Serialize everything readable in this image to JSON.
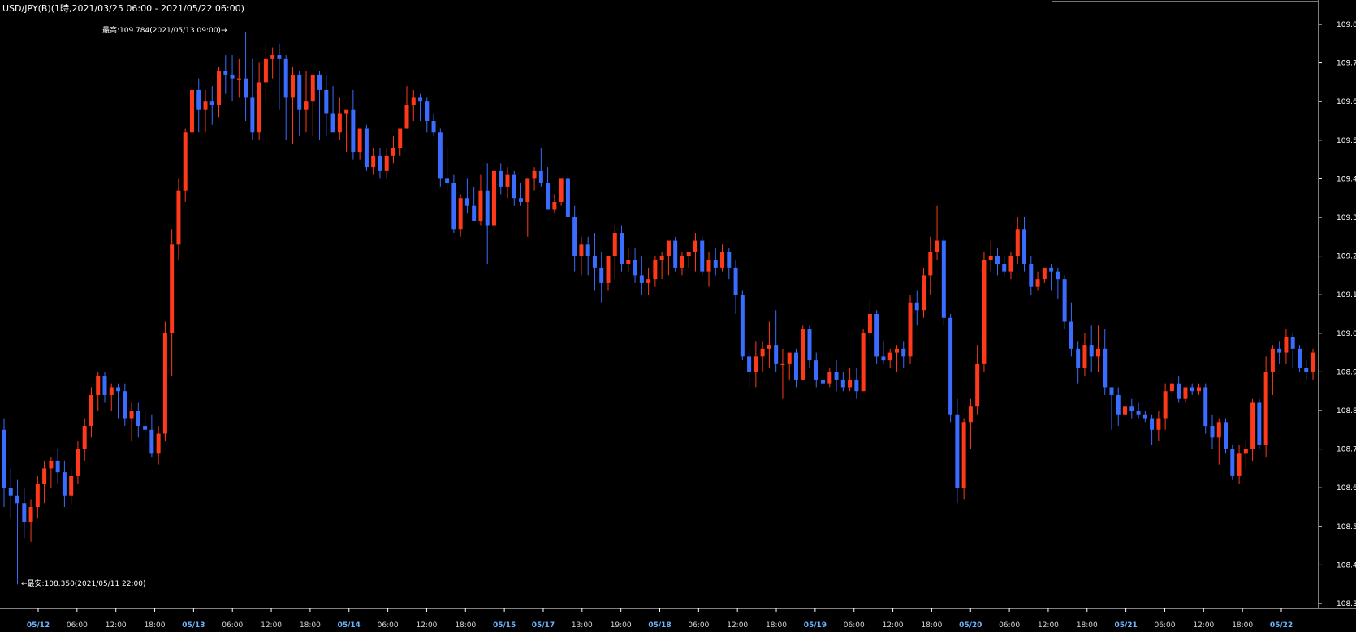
{
  "chart_data": {
    "type": "candlestick",
    "title": "USD/JPY(B)(1時,2021/03/25 06:00 - 2021/05/22 06:00)",
    "annotations": {
      "high": "最高:109.784(2021/05/13 09:00)→",
      "low": "←最安:108.350(2021/05/11 22:00)"
    },
    "ylim": [
      108.27,
      109.86
    ],
    "y_ticks": [
      "109.8",
      "109.7",
      "109.6",
      "109.5",
      "109.4",
      "109.3",
      "109.2",
      "109.1",
      "109.0",
      "108.9",
      "108.8",
      "108.7",
      "108.6",
      "108.5",
      "108.4",
      "108.3"
    ],
    "x_ticks": [
      {
        "label": "05/12",
        "date": true
      },
      {
        "label": "06:00",
        "date": false
      },
      {
        "label": "12:00",
        "date": false
      },
      {
        "label": "18:00",
        "date": false
      },
      {
        "label": "05/13",
        "date": true
      },
      {
        "label": "06:00",
        "date": false
      },
      {
        "label": "12:00",
        "date": false
      },
      {
        "label": "18:00",
        "date": false
      },
      {
        "label": "05/14",
        "date": true
      },
      {
        "label": "06:00",
        "date": false
      },
      {
        "label": "12:00",
        "date": false
      },
      {
        "label": "18:00",
        "date": false
      },
      {
        "label": "05/15",
        "date": true
      },
      {
        "label": "05/17",
        "date": true
      },
      {
        "label": "13:00",
        "date": false
      },
      {
        "label": "19:00",
        "date": false
      },
      {
        "label": "05/18",
        "date": true
      },
      {
        "label": "06:00",
        "date": false
      },
      {
        "label": "12:00",
        "date": false
      },
      {
        "label": "18:00",
        "date": false
      },
      {
        "label": "05/19",
        "date": true
      },
      {
        "label": "06:00",
        "date": false
      },
      {
        "label": "12:00",
        "date": false
      },
      {
        "label": "18:00",
        "date": false
      },
      {
        "label": "05/20",
        "date": true
      },
      {
        "label": "06:00",
        "date": false
      },
      {
        "label": "12:00",
        "date": false
      },
      {
        "label": "18:00",
        "date": false
      },
      {
        "label": "05/21",
        "date": true
      },
      {
        "label": "06:00",
        "date": false
      },
      {
        "label": "12:00",
        "date": false
      },
      {
        "label": "18:00",
        "date": false
      },
      {
        "label": "05/22",
        "date": true
      }
    ],
    "colors": {
      "up": "#ff3a1a",
      "down": "#3a6cff",
      "background": "#000000",
      "axis": "#ffffff",
      "text": "#ffffff",
      "date_label": "#6fb4ff"
    },
    "candles": [
      [
        108.75,
        108.78,
        108.55,
        108.6
      ],
      [
        108.6,
        108.65,
        108.52,
        108.58
      ],
      [
        108.58,
        108.62,
        108.35,
        108.56
      ],
      [
        108.56,
        108.6,
        108.47,
        108.51
      ],
      [
        108.51,
        108.57,
        108.46,
        108.55
      ],
      [
        108.55,
        108.63,
        108.52,
        108.61
      ],
      [
        108.61,
        108.67,
        108.56,
        108.65
      ],
      [
        108.65,
        108.68,
        108.6,
        108.67
      ],
      [
        108.67,
        108.7,
        108.61,
        108.64
      ],
      [
        108.64,
        108.67,
        108.55,
        108.58
      ],
      [
        108.58,
        108.65,
        108.56,
        108.63
      ],
      [
        108.63,
        108.72,
        108.61,
        108.7
      ],
      [
        108.7,
        108.78,
        108.67,
        108.76
      ],
      [
        108.76,
        108.86,
        108.73,
        108.84
      ],
      [
        108.84,
        108.9,
        108.8,
        108.89
      ],
      [
        108.89,
        108.9,
        108.82,
        108.84
      ],
      [
        108.84,
        108.87,
        108.8,
        108.86
      ],
      [
        108.86,
        108.87,
        108.78,
        108.85
      ],
      [
        108.85,
        108.87,
        108.76,
        108.78
      ],
      [
        108.78,
        108.82,
        108.72,
        108.8
      ],
      [
        108.8,
        108.82,
        108.73,
        108.76
      ],
      [
        108.76,
        108.8,
        108.71,
        108.75
      ],
      [
        108.75,
        108.79,
        108.68,
        108.69
      ],
      [
        108.69,
        108.76,
        108.66,
        108.74
      ],
      [
        108.74,
        109.03,
        108.72,
        109.0
      ],
      [
        109.0,
        109.27,
        108.89,
        109.23
      ],
      [
        109.23,
        109.4,
        109.19,
        109.37
      ],
      [
        109.37,
        109.53,
        109.34,
        109.52
      ],
      [
        109.52,
        109.65,
        109.49,
        109.63
      ],
      [
        109.63,
        109.66,
        109.52,
        109.58
      ],
      [
        109.58,
        109.63,
        109.52,
        109.6
      ],
      [
        109.6,
        109.64,
        109.54,
        109.59
      ],
      [
        109.59,
        109.69,
        109.56,
        109.68
      ],
      [
        109.68,
        109.72,
        109.62,
        109.67
      ],
      [
        109.67,
        109.72,
        109.6,
        109.66
      ],
      [
        109.66,
        109.71,
        109.61,
        109.66
      ],
      [
        109.66,
        109.78,
        109.55,
        109.61
      ],
      [
        109.61,
        109.71,
        109.5,
        109.52
      ],
      [
        109.52,
        109.7,
        109.5,
        109.65
      ],
      [
        109.65,
        109.75,
        109.6,
        109.71
      ],
      [
        109.71,
        109.74,
        109.66,
        109.72
      ],
      [
        109.72,
        109.75,
        109.58,
        109.71
      ],
      [
        109.71,
        109.72,
        109.5,
        109.61
      ],
      [
        109.61,
        109.69,
        109.49,
        109.67
      ],
      [
        109.67,
        109.68,
        109.51,
        109.58
      ],
      [
        109.58,
        109.68,
        109.52,
        109.6
      ],
      [
        109.6,
        109.66,
        109.51,
        109.67
      ],
      [
        109.67,
        109.68,
        109.5,
        109.63
      ],
      [
        109.63,
        109.67,
        109.51,
        109.57
      ],
      [
        109.57,
        109.64,
        109.54,
        109.52
      ],
      [
        109.52,
        109.61,
        109.5,
        109.57
      ],
      [
        109.57,
        109.58,
        109.47,
        109.58
      ],
      [
        109.58,
        109.63,
        109.45,
        109.47
      ],
      [
        109.47,
        109.52,
        109.45,
        109.53
      ],
      [
        109.53,
        109.54,
        109.42,
        109.43
      ],
      [
        109.43,
        109.48,
        109.41,
        109.46
      ],
      [
        109.46,
        109.48,
        109.4,
        109.42
      ],
      [
        109.42,
        109.48,
        109.4,
        109.46
      ],
      [
        109.46,
        109.51,
        109.44,
        109.48
      ],
      [
        109.48,
        109.53,
        109.46,
        109.53
      ],
      [
        109.53,
        109.64,
        109.53,
        109.59
      ],
      [
        109.59,
        109.63,
        109.55,
        109.61
      ],
      [
        109.61,
        109.62,
        109.55,
        109.6
      ],
      [
        109.6,
        109.61,
        109.52,
        109.55
      ],
      [
        109.55,
        109.57,
        109.51,
        109.52
      ],
      [
        109.52,
        109.53,
        109.38,
        109.4
      ],
      [
        109.4,
        109.48,
        109.37,
        109.39
      ],
      [
        109.39,
        109.41,
        109.26,
        109.27
      ],
      [
        109.27,
        109.36,
        109.25,
        109.35
      ],
      [
        109.35,
        109.4,
        109.31,
        109.33
      ],
      [
        109.33,
        109.38,
        109.29,
        109.29
      ],
      [
        109.29,
        109.41,
        109.28,
        109.37
      ],
      [
        109.37,
        109.44,
        109.18,
        109.28
      ],
      [
        109.28,
        109.45,
        109.26,
        109.42
      ],
      [
        109.42,
        109.44,
        109.36,
        109.38
      ],
      [
        109.38,
        109.43,
        109.35,
        109.41
      ],
      [
        109.41,
        109.42,
        109.33,
        109.35
      ],
      [
        109.35,
        109.39,
        109.33,
        109.34
      ],
      [
        109.34,
        109.38,
        109.25,
        109.4
      ],
      [
        109.4,
        109.43,
        109.37,
        109.42
      ],
      [
        109.42,
        109.48,
        109.38,
        109.39
      ],
      [
        109.39,
        109.43,
        109.36,
        109.32
      ],
      [
        109.32,
        109.36,
        109.31,
        109.34
      ],
      [
        109.34,
        109.4,
        109.33,
        109.4
      ],
      [
        109.4,
        109.41,
        109.31,
        109.3
      ],
      [
        109.3,
        109.33,
        109.16,
        109.2
      ],
      [
        109.2,
        109.25,
        109.15,
        109.23
      ],
      [
        109.23,
        109.25,
        109.15,
        109.2
      ],
      [
        109.2,
        109.26,
        109.11,
        109.17
      ],
      [
        109.17,
        109.21,
        109.08,
        109.13
      ],
      [
        109.13,
        109.19,
        109.11,
        109.2
      ],
      [
        109.2,
        109.28,
        109.14,
        109.26
      ],
      [
        109.26,
        109.28,
        109.16,
        109.18
      ],
      [
        109.18,
        109.22,
        109.16,
        109.19
      ],
      [
        109.19,
        109.22,
        109.13,
        109.15
      ],
      [
        109.15,
        109.2,
        109.1,
        109.13
      ],
      [
        109.13,
        109.17,
        109.1,
        109.14
      ],
      [
        109.14,
        109.2,
        109.12,
        109.19
      ],
      [
        109.19,
        109.21,
        109.14,
        109.2
      ],
      [
        109.2,
        109.24,
        109.15,
        109.24
      ],
      [
        109.24,
        109.25,
        109.16,
        109.17
      ],
      [
        109.17,
        109.21,
        109.15,
        109.2
      ],
      [
        109.2,
        109.21,
        109.17,
        109.21
      ],
      [
        109.21,
        109.26,
        109.16,
        109.24
      ],
      [
        109.24,
        109.25,
        109.15,
        109.16
      ],
      [
        109.16,
        109.21,
        109.12,
        109.19
      ],
      [
        109.19,
        109.22,
        109.15,
        109.17
      ],
      [
        109.17,
        109.23,
        109.16,
        109.21
      ],
      [
        109.21,
        109.22,
        109.14,
        109.17
      ],
      [
        109.17,
        109.19,
        109.05,
        109.1
      ],
      [
        109.1,
        109.11,
        108.93,
        108.94
      ],
      [
        108.94,
        108.96,
        108.86,
        108.9
      ],
      [
        108.9,
        108.98,
        108.86,
        108.94
      ],
      [
        108.94,
        108.98,
        108.9,
        108.96
      ],
      [
        108.96,
        109.03,
        108.91,
        108.97
      ],
      [
        108.97,
        109.06,
        108.9,
        108.92
      ],
      [
        108.92,
        108.96,
        108.83,
        108.92
      ],
      [
        108.92,
        108.95,
        108.88,
        108.95
      ],
      [
        108.95,
        108.96,
        108.86,
        108.88
      ],
      [
        108.88,
        109.02,
        108.88,
        109.01
      ],
      [
        109.01,
        109.02,
        108.91,
        108.93
      ],
      [
        108.93,
        108.95,
        108.86,
        108.88
      ],
      [
        108.88,
        108.92,
        108.85,
        108.87
      ],
      [
        108.87,
        108.91,
        108.86,
        108.9
      ],
      [
        108.9,
        108.93,
        108.85,
        108.88
      ],
      [
        108.88,
        108.9,
        108.85,
        108.86
      ],
      [
        108.86,
        108.91,
        108.85,
        108.88
      ],
      [
        108.88,
        108.91,
        108.83,
        108.85
      ],
      [
        108.85,
        109.01,
        108.85,
        109.0
      ],
      [
        109.0,
        109.09,
        108.97,
        109.05
      ],
      [
        109.05,
        109.06,
        108.92,
        108.94
      ],
      [
        108.94,
        108.98,
        108.92,
        108.93
      ],
      [
        108.93,
        108.96,
        108.91,
        108.95
      ],
      [
        108.95,
        108.97,
        108.9,
        108.96
      ],
      [
        108.96,
        108.98,
        108.91,
        108.94
      ],
      [
        108.94,
        109.1,
        108.92,
        109.08
      ],
      [
        109.08,
        109.11,
        109.02,
        109.06
      ],
      [
        109.06,
        109.17,
        109.04,
        109.15
      ],
      [
        109.15,
        109.25,
        109.1,
        109.21
      ],
      [
        109.21,
        109.33,
        109.19,
        109.24
      ],
      [
        109.24,
        109.25,
        109.02,
        109.04
      ],
      [
        109.04,
        109.05,
        108.77,
        108.79
      ],
      [
        108.79,
        108.83,
        108.56,
        108.6
      ],
      [
        108.6,
        108.78,
        108.57,
        108.77
      ],
      [
        108.77,
        108.83,
        108.7,
        108.81
      ],
      [
        108.81,
        108.97,
        108.79,
        108.92
      ],
      [
        108.92,
        109.21,
        108.9,
        109.19
      ],
      [
        109.19,
        109.24,
        109.16,
        109.2
      ],
      [
        109.2,
        109.22,
        109.15,
        109.18
      ],
      [
        109.18,
        109.2,
        109.15,
        109.16
      ],
      [
        109.16,
        109.21,
        109.14,
        109.2
      ],
      [
        109.2,
        109.3,
        109.18,
        109.27
      ],
      [
        109.27,
        109.3,
        109.16,
        109.18
      ],
      [
        109.18,
        109.2,
        109.1,
        109.12
      ],
      [
        109.12,
        109.16,
        109.11,
        109.14
      ],
      [
        109.14,
        109.17,
        109.13,
        109.17
      ],
      [
        109.17,
        109.18,
        109.11,
        109.16
      ],
      [
        109.16,
        109.17,
        109.09,
        109.14
      ],
      [
        109.14,
        109.15,
        109.01,
        109.03
      ],
      [
        109.03,
        109.08,
        108.94,
        108.96
      ],
      [
        108.96,
        108.98,
        108.87,
        108.91
      ],
      [
        108.91,
        109.0,
        108.89,
        108.97
      ],
      [
        108.97,
        109.02,
        108.9,
        108.94
      ],
      [
        108.94,
        109.02,
        108.9,
        108.96
      ],
      [
        108.96,
        109.01,
        108.84,
        108.86
      ],
      [
        108.86,
        108.86,
        108.75,
        108.84
      ],
      [
        108.84,
        108.86,
        108.76,
        108.79
      ],
      [
        108.79,
        108.83,
        108.78,
        108.81
      ],
      [
        108.81,
        108.83,
        108.78,
        108.8
      ],
      [
        108.8,
        108.82,
        108.78,
        108.79
      ],
      [
        108.79,
        108.8,
        108.77,
        108.78
      ],
      [
        108.78,
        108.79,
        108.71,
        108.75
      ],
      [
        108.75,
        108.8,
        108.72,
        108.78
      ],
      [
        108.78,
        108.87,
        108.75,
        108.85
      ],
      [
        108.85,
        108.88,
        108.83,
        108.87
      ],
      [
        108.87,
        108.89,
        108.82,
        108.83
      ],
      [
        108.83,
        108.85,
        108.82,
        108.86
      ],
      [
        108.86,
        108.87,
        108.84,
        108.85
      ],
      [
        108.85,
        108.87,
        108.84,
        108.86
      ],
      [
        108.86,
        108.87,
        108.74,
        108.76
      ],
      [
        108.76,
        108.79,
        108.7,
        108.73
      ],
      [
        108.73,
        108.78,
        108.66,
        108.77
      ],
      [
        108.77,
        108.78,
        108.69,
        108.7
      ],
      [
        108.7,
        108.71,
        108.62,
        108.63
      ],
      [
        108.63,
        108.71,
        108.61,
        108.69
      ],
      [
        108.69,
        108.72,
        108.65,
        108.7
      ],
      [
        108.7,
        108.83,
        108.67,
        108.82
      ],
      [
        108.82,
        108.83,
        108.7,
        108.71
      ],
      [
        108.71,
        108.94,
        108.68,
        108.9
      ],
      [
        108.9,
        108.97,
        108.84,
        108.96
      ],
      [
        108.96,
        108.98,
        108.92,
        108.95
      ],
      [
        108.95,
        109.01,
        108.92,
        108.99
      ],
      [
        108.99,
        109.0,
        108.91,
        108.96
      ],
      [
        108.96,
        108.97,
        108.9,
        108.91
      ],
      [
        108.91,
        108.93,
        108.88,
        108.9
      ],
      [
        108.9,
        108.96,
        108.88,
        108.95
      ]
    ]
  }
}
